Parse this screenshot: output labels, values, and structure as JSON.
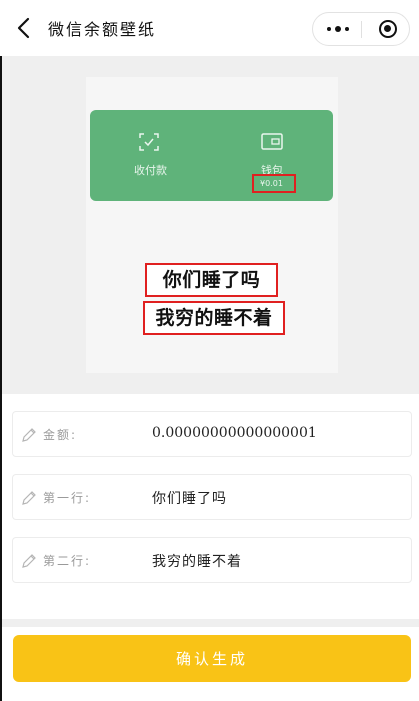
{
  "header": {
    "title": "微信余额壁纸"
  },
  "preview": {
    "collect_label": "收付款",
    "wallet_label": "钱包",
    "balance": "¥0.01",
    "line1": "你们睡了吗",
    "line2": "我穷的睡不着",
    "accent_color": "#5fb37a",
    "highlight_color": "#e02020"
  },
  "form": {
    "amount_label": "金额:",
    "amount_value": "0.00000000000000001",
    "line1_label": "第一行:",
    "line1_value": "你们睡了吗",
    "line2_label": "第二行:",
    "line2_value": "我穷的睡不着"
  },
  "actions": {
    "confirm_label": "确认生成",
    "confirm_color": "#f9c316"
  }
}
